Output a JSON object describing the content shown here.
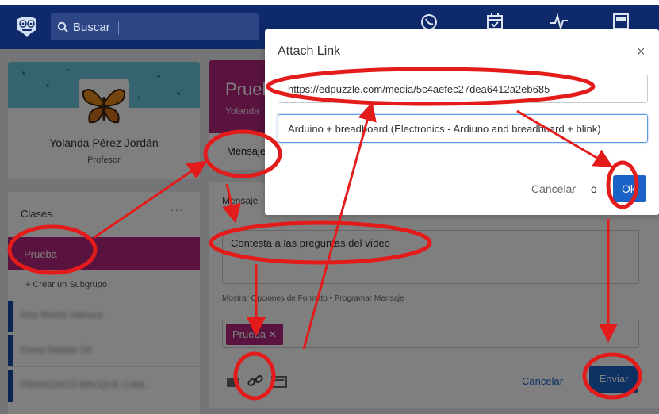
{
  "search": {
    "placeholder": "Buscar"
  },
  "nav_icons": [
    "moon-phone-icon",
    "calendar-check-icon",
    "activity-pulse-icon",
    "bookmark-library-icon"
  ],
  "profile": {
    "name": "Yolanda Pérez Jordán",
    "role": "Profesor"
  },
  "classes": {
    "title": "Clases",
    "more": "···",
    "active": "Prueba",
    "create_subgroup": "+ Crear un Subgrupo",
    "students": [
      "Kira Martín Valsuca",
      "Elena Natalie Gil",
      "FRANCISCO BRUQUE CAM..."
    ]
  },
  "main": {
    "group_title": "Prueba",
    "group_owner": "Yolanda",
    "tab": "Mensaje",
    "composer_label": "Mensaje",
    "message": "Contesta a las preguntas del vídeo",
    "format_options": "Mostrar Opciones de Formato  •  Programar Mensaje",
    "recipient_chip": "Prueba ✕",
    "cancel": "Cancelar",
    "send": "Enviar"
  },
  "modal": {
    "title": "Attach Link",
    "close": "×",
    "url": "https://edpuzzle.com/media/5c4aefec27dea6412a2eb685",
    "link_title": "Arduino + breadboard (Electronics - Ardiuno and breadboard + blink)",
    "cancel": "Cancelar",
    "or": "o",
    "ok": "Ok"
  },
  "colors": {
    "brand": "#0e2a6b",
    "accent": "#b3277d",
    "primary": "#1b62c6",
    "annotation": "#e41b1b"
  }
}
